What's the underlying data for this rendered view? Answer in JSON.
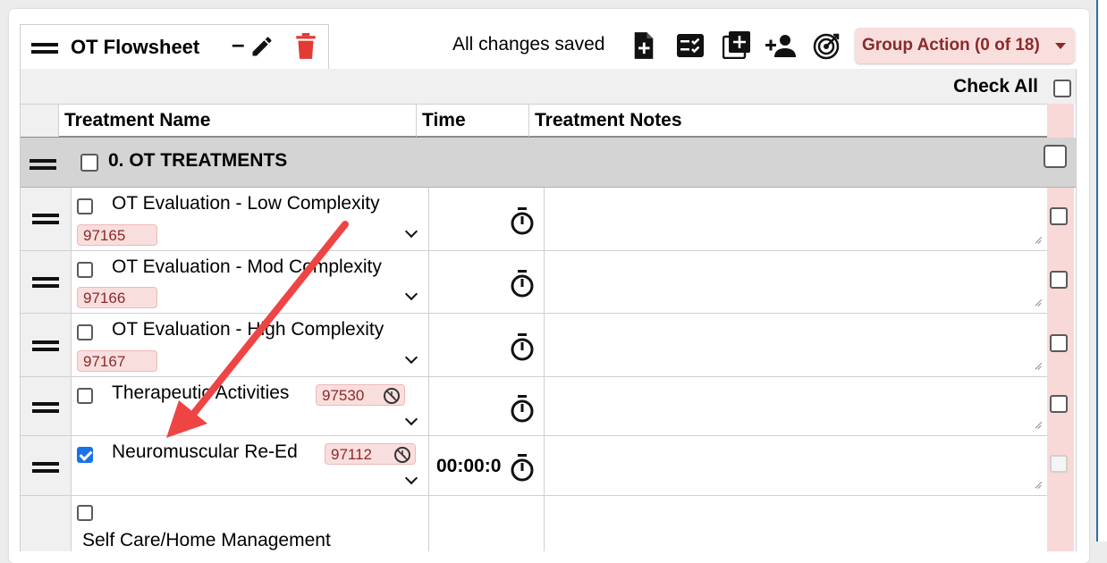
{
  "tab": {
    "title": "OT Flowsheet",
    "minus_label": "–"
  },
  "toolbar": {
    "status": "All changes saved",
    "group_action_label": "Group Action (0 of 18)"
  },
  "check_all_label": "Check All",
  "columns": {
    "name": "Treatment Name",
    "time": "Time",
    "notes": "Treatment Notes"
  },
  "group": {
    "label": "0. OT TREATMENTS"
  },
  "rows": [
    {
      "name": "OT Evaluation - Low Complexity",
      "code": "97165",
      "checked": false
    },
    {
      "name": "OT Evaluation - Mod Complexity",
      "code": "97166",
      "checked": false
    },
    {
      "name": "OT Evaluation - High Complexity",
      "code": "97167",
      "checked": false
    },
    {
      "name": "Therapeutic Activities",
      "code": "97530",
      "checked": false
    },
    {
      "name": "Neuromuscular Re-Ed",
      "code": "97112",
      "checked": true,
      "time": "00:00:0"
    },
    {
      "name": "Self Care/Home Management",
      "checked": false
    }
  ],
  "colors": {
    "accent_red": "#e53935",
    "code_text": "#8b2a2a",
    "code_bg": "#f9dede",
    "checkbox_blue": "#1a73e8",
    "annotation_arrow": "#ef4444"
  },
  "icons": {
    "edit": "pencil-icon",
    "delete": "trash-icon",
    "add_doc": "file-plus-icon",
    "checklist": "checklist-icon",
    "add_box": "plus-box-icon",
    "add_person": "person-add-icon",
    "target": "target-icon",
    "timer": "stopwatch-icon",
    "restricted": "no-clock-icon"
  }
}
